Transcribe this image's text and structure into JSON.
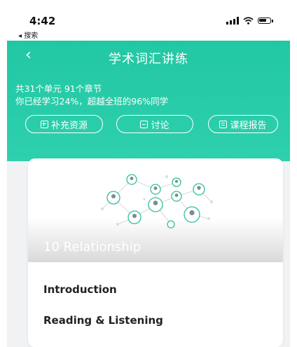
{
  "status": {
    "time": "4:42",
    "back_app": "◂ 搜索"
  },
  "header": {
    "back_icon": "‹",
    "title": "学术词汇讲练",
    "summary_line1": "共31个单元 91个章节",
    "summary_line2": "你已经学习24%，超越全班的96%同学",
    "progress": {
      "self_percent": 24,
      "beat_percent": 96
    },
    "actions": [
      {
        "label": "补充资源",
        "icon": "plus-square-icon"
      },
      {
        "label": "讨论",
        "icon": "chat-icon"
      },
      {
        "label": "课程报告",
        "icon": "report-icon"
      }
    ],
    "accent_color": "#25c9a6"
  },
  "card": {
    "unit_title": "10 Relationship",
    "items": [
      {
        "label": "Introduction"
      },
      {
        "label": "Reading & Listening"
      }
    ]
  }
}
